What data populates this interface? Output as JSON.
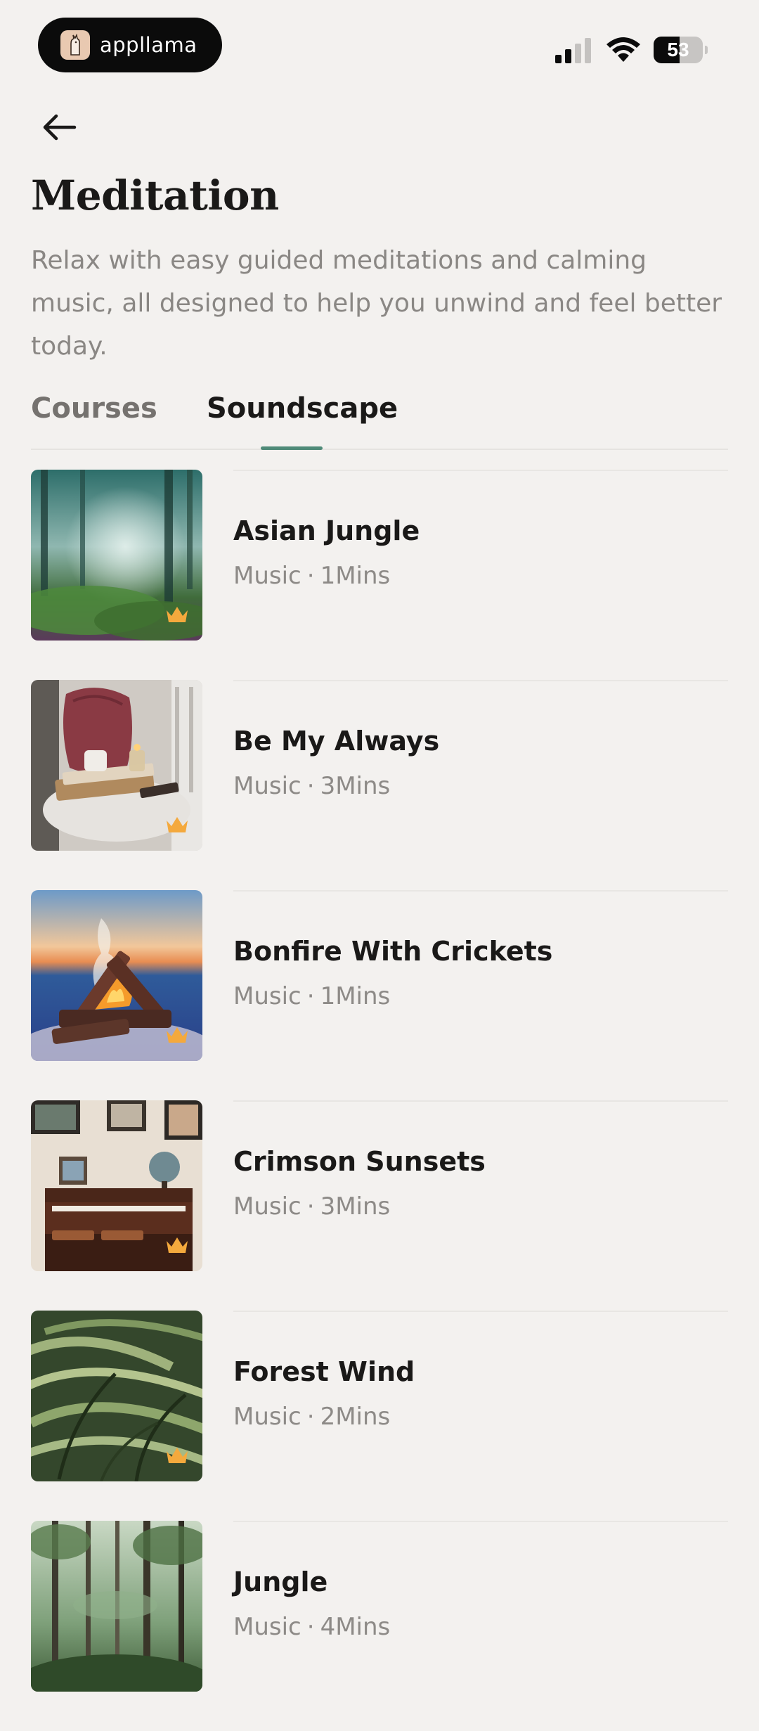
{
  "status_bar": {
    "brand_name": "appllama",
    "battery_level": "53",
    "battery_fraction": 0.53
  },
  "header": {
    "title": "Meditation",
    "description": "Relax with easy guided meditations and calming music, all designed to help you unwind and feel better today."
  },
  "tabs": [
    {
      "label": "Courses",
      "active": false
    },
    {
      "label": "Soundscape",
      "active": true
    }
  ],
  "accent_color": "#4f8a78",
  "premium_color": "#f4a93d",
  "tracks": [
    {
      "title": "Asian Jungle",
      "type": "Music",
      "separator": "·",
      "duration": "1Mins",
      "premium": true,
      "thumbnail": "misty-forest"
    },
    {
      "title": "Be My Always",
      "type": "Music",
      "separator": "·",
      "duration": "3Mins",
      "premium": true,
      "thumbnail": "cozy-pillow-candle"
    },
    {
      "title": "Bonfire With Crickets",
      "type": "Music",
      "separator": "·",
      "duration": "1Mins",
      "premium": true,
      "thumbnail": "bonfire-sunset"
    },
    {
      "title": "Crimson Sunsets",
      "type": "Music",
      "separator": "·",
      "duration": "3Mins",
      "premium": true,
      "thumbnail": "piano-room"
    },
    {
      "title": "Forest Wind",
      "type": "Music",
      "separator": "·",
      "duration": "2Mins",
      "premium": true,
      "thumbnail": "wind-grass"
    },
    {
      "title": "Jungle",
      "type": "Music",
      "separator": "·",
      "duration": "4Mins",
      "premium": false,
      "thumbnail": "tall-jungle-trees"
    }
  ]
}
